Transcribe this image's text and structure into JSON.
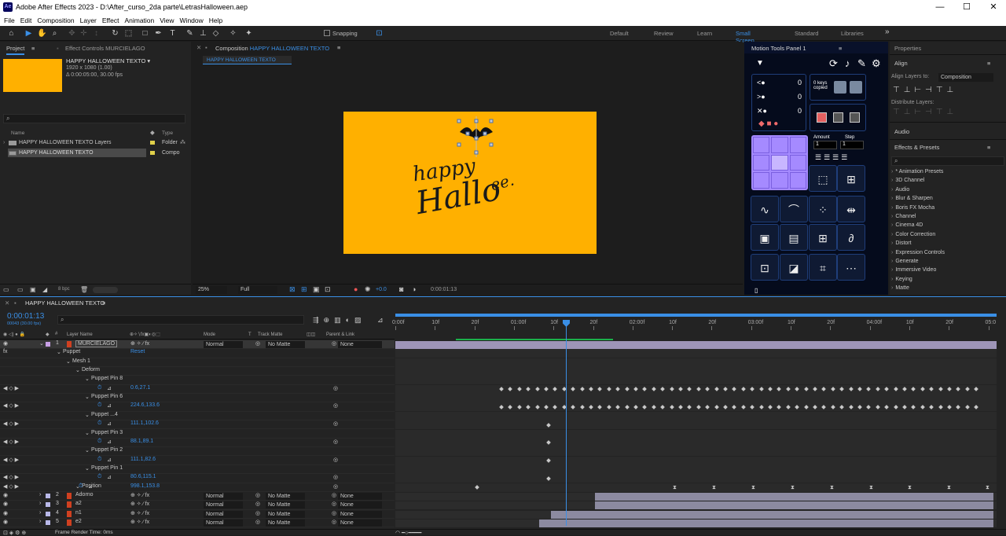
{
  "window": {
    "title": "Adobe After Effects 2023 - D:\\After_curso_2da parte\\LetrasHalloween.aep",
    "logo": "Ae",
    "min": "—",
    "max": "☐",
    "close": "✕"
  },
  "menu": [
    "File",
    "Edit",
    "Composition",
    "Layer",
    "Effect",
    "Animation",
    "View",
    "Window",
    "Help"
  ],
  "toolbar": {
    "snapping": "Snapping",
    "workspaces": [
      "Default",
      "Review",
      "Learn",
      "Small Screen",
      "Standard",
      "Libraries"
    ],
    "active_ws": "Small Screen",
    "more": "»"
  },
  "project": {
    "tab": "Project",
    "effect_tab": "Effect Controls MURCIELAGO",
    "comp_name": "HAPPY HALLOWEEN TEXTO ▾",
    "comp_size": "1920 x 1080 (1.00)",
    "comp_dur": "Δ 0:00:05:00, 30.00 fps",
    "col_name": "Name",
    "col_type": "Type",
    "items": [
      {
        "name": "HAPPY HALLOWEEN TEXTO Layers",
        "type": "Folder"
      },
      {
        "name": "HAPPY HALLOWEEN TEXTO",
        "type": "Compo"
      }
    ],
    "bpc": "8 bpc",
    "search_icon": "search-icon"
  },
  "comp": {
    "tab_prefix": "Composition",
    "tab_name": "HAPPY HALLOWEEN TEXTO",
    "subtab": "HAPPY HALLOWEEN TEXTO",
    "zoom": "25%",
    "quality": "Full",
    "exposure": "+0.0",
    "time": "0:00:01:13",
    "bg_color": "#ffb000",
    "text1": "happy",
    "text2": "Hallo",
    "text3": "ee."
  },
  "motion": {
    "tab": "Motion Tools Panel 1",
    "keys": "0 keys copied",
    "amount": "Amount",
    "step": "Step",
    "amount_val": "1",
    "step_val": "1",
    "rows": [
      "0",
      "0",
      "0"
    ]
  },
  "properties": {
    "tab": "Properties",
    "align": "Align",
    "align_to": "Align Layers to:",
    "align_val": "Composition",
    "distribute": "Distribute Layers:",
    "audio": "Audio",
    "effects": "Effects & Presets",
    "effect_list": [
      "* Animation Presets",
      "3D Channel",
      "Audio",
      "Blur & Sharpen",
      "Boris FX Mocha",
      "Channel",
      "Cinema 4D",
      "Color Correction",
      "Distort",
      "Expression Controls",
      "Generate",
      "Immersive Video",
      "Keying",
      "Matte"
    ]
  },
  "timeline": {
    "tab": "HAPPY HALLOWEEN TEXTO",
    "time": "0:00:01:13",
    "fps": "00043 (30.00 fps)",
    "col_layer": "Layer Name",
    "col_mode": "Mode",
    "col_t": "T",
    "col_matte": "Track Matte",
    "col_parent": "Parent & Link",
    "ruler": [
      "0:00f",
      "10f",
      "20f",
      "01:00f",
      "10f",
      "20f",
      "02:00f",
      "10f",
      "20f",
      "03:00f",
      "10f",
      "20f",
      "04:00f",
      "10f",
      "20f",
      "05:0"
    ],
    "layers": [
      {
        "num": "1",
        "name": "MURCIELAGO",
        "mode": "Normal",
        "matte": "No Matte",
        "parent": "None"
      },
      {
        "num": "2",
        "name": "Adorno",
        "mode": "Normal",
        "matte": "No Matte",
        "parent": "None"
      },
      {
        "num": "3",
        "name": "a2",
        "mode": "Normal",
        "matte": "No Matte",
        "parent": "None"
      },
      {
        "num": "4",
        "name": "n1",
        "mode": "Normal",
        "matte": "No Matte",
        "parent": "None"
      },
      {
        "num": "5",
        "name": "e2",
        "mode": "Normal",
        "matte": "No Matte",
        "parent": "None"
      }
    ],
    "props": [
      {
        "name": "Puppet",
        "val": "Reset",
        "indent": 80
      },
      {
        "name": "Mesh 1",
        "val": "",
        "indent": 92
      },
      {
        "name": "Deform",
        "val": "",
        "indent": 104
      },
      {
        "name": "Puppet Pin 8",
        "val": "",
        "indent": 116
      },
      {
        "name": "",
        "val": "0.6,27.1",
        "indent": 128
      },
      {
        "name": "Puppet Pin 6",
        "val": "",
        "indent": 116
      },
      {
        "name": "",
        "val": "224.6,133.6",
        "indent": 128
      },
      {
        "name": "Puppet ...4",
        "val": "",
        "indent": 116
      },
      {
        "name": "",
        "val": "111.1,102.6",
        "indent": 128
      },
      {
        "name": "Puppet Pin 3",
        "val": "",
        "indent": 116
      },
      {
        "name": "",
        "val": "88.1,89.1",
        "indent": 128
      },
      {
        "name": "Puppet Pin 2",
        "val": "",
        "indent": 116
      },
      {
        "name": "",
        "val": "111.1,82.6",
        "indent": 128
      },
      {
        "name": "Puppet Pin 1",
        "val": "",
        "indent": 116
      },
      {
        "name": "",
        "val": "80.6,115.1",
        "indent": 128
      },
      {
        "name": "Position",
        "val": "998.1,153.8",
        "indent": 104
      }
    ],
    "render_time": "Frame Render Time: 0ms",
    "reset": "Reset",
    "fx": "fx"
  }
}
